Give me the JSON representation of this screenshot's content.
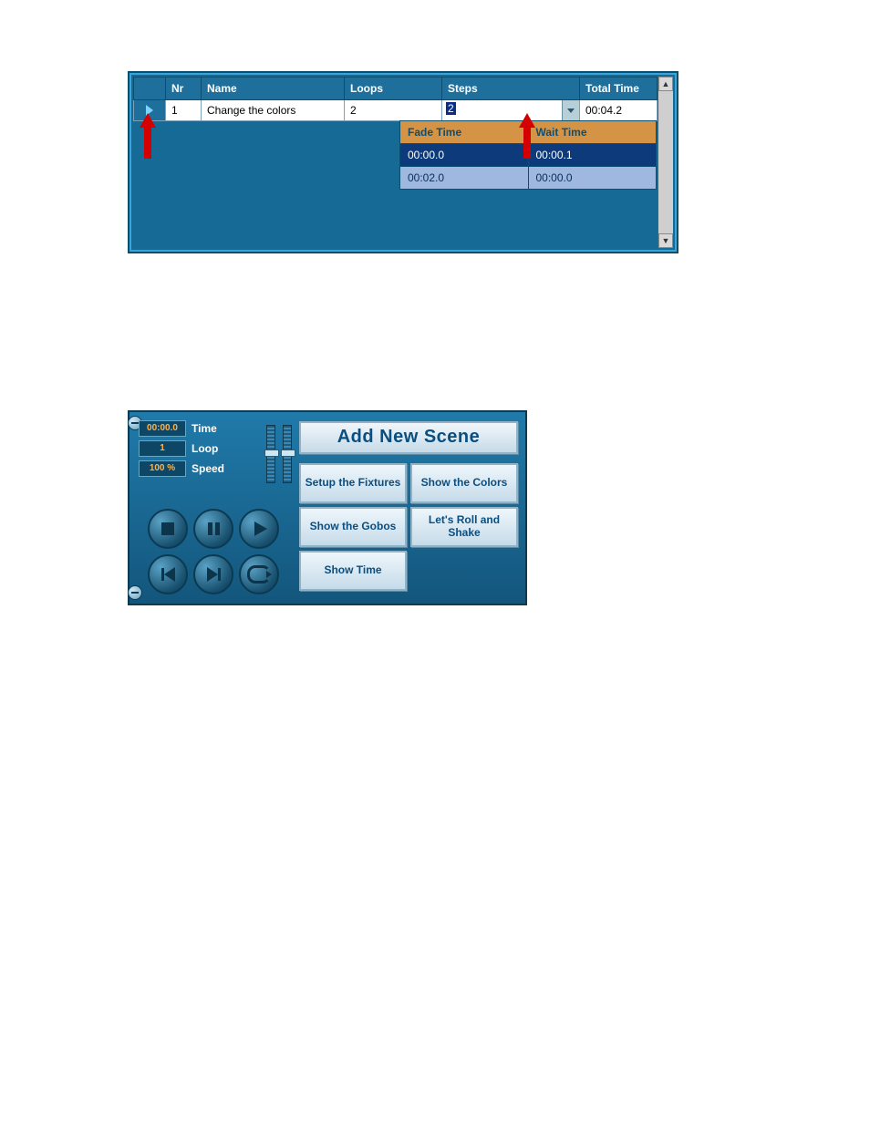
{
  "table": {
    "headers": {
      "nr": "Nr",
      "name": "Name",
      "loops": "Loops",
      "steps": "Steps",
      "total": "Total Time"
    },
    "row": {
      "nr": "1",
      "name": "Change the colors",
      "loops": "2",
      "steps": "2",
      "total": "00:04.2"
    },
    "sub": {
      "fade_header": "Fade Time",
      "wait_header": "Wait Time",
      "rows": [
        {
          "fade": "00:00.0",
          "wait": "00:00.1"
        },
        {
          "fade": "00:02.0",
          "wait": "00:00.0"
        }
      ]
    }
  },
  "playback": {
    "time_value": "00:00.0",
    "time_label": "Time",
    "loop_value": "1",
    "loop_label": "Loop",
    "speed_value": "100 %",
    "speed_label": "Speed",
    "add_scene": "Add New Scene",
    "buttons": [
      "Setup the Fixtures",
      "Show the Colors",
      "Show the Gobos",
      "Let's Roll and Shake",
      "Show Time"
    ]
  }
}
